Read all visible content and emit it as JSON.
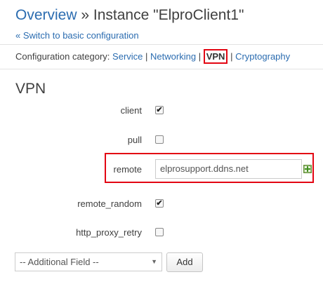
{
  "header": {
    "title_link": "Overview",
    "title_separator": " » ",
    "title_rest": "Instance \"ElproClient1\"",
    "switch_link": "« Switch to basic configuration"
  },
  "category": {
    "label": "Configuration category:",
    "items": [
      "Service",
      "Networking",
      "VPN",
      "Cryptography"
    ],
    "active": "VPN",
    "separator": "|"
  },
  "section_title": "VPN",
  "fields": {
    "client": {
      "label": "client",
      "checked": true
    },
    "pull": {
      "label": "pull",
      "checked": false
    },
    "remote": {
      "label": "remote",
      "value": "elprosupport.ddns.net"
    },
    "remote_random": {
      "label": "remote_random",
      "checked": true
    },
    "http_proxy_retry": {
      "label": "http_proxy_retry",
      "checked": false
    }
  },
  "additional": {
    "select_value": "-- Additional Field --",
    "add_label": "Add"
  },
  "colors": {
    "link": "#2b6cb0",
    "highlight": "#e30613"
  },
  "icons": {
    "add_row": "add-row-icon",
    "dropdown": "chevron-down-icon",
    "checkmark": "checkmark-icon"
  }
}
